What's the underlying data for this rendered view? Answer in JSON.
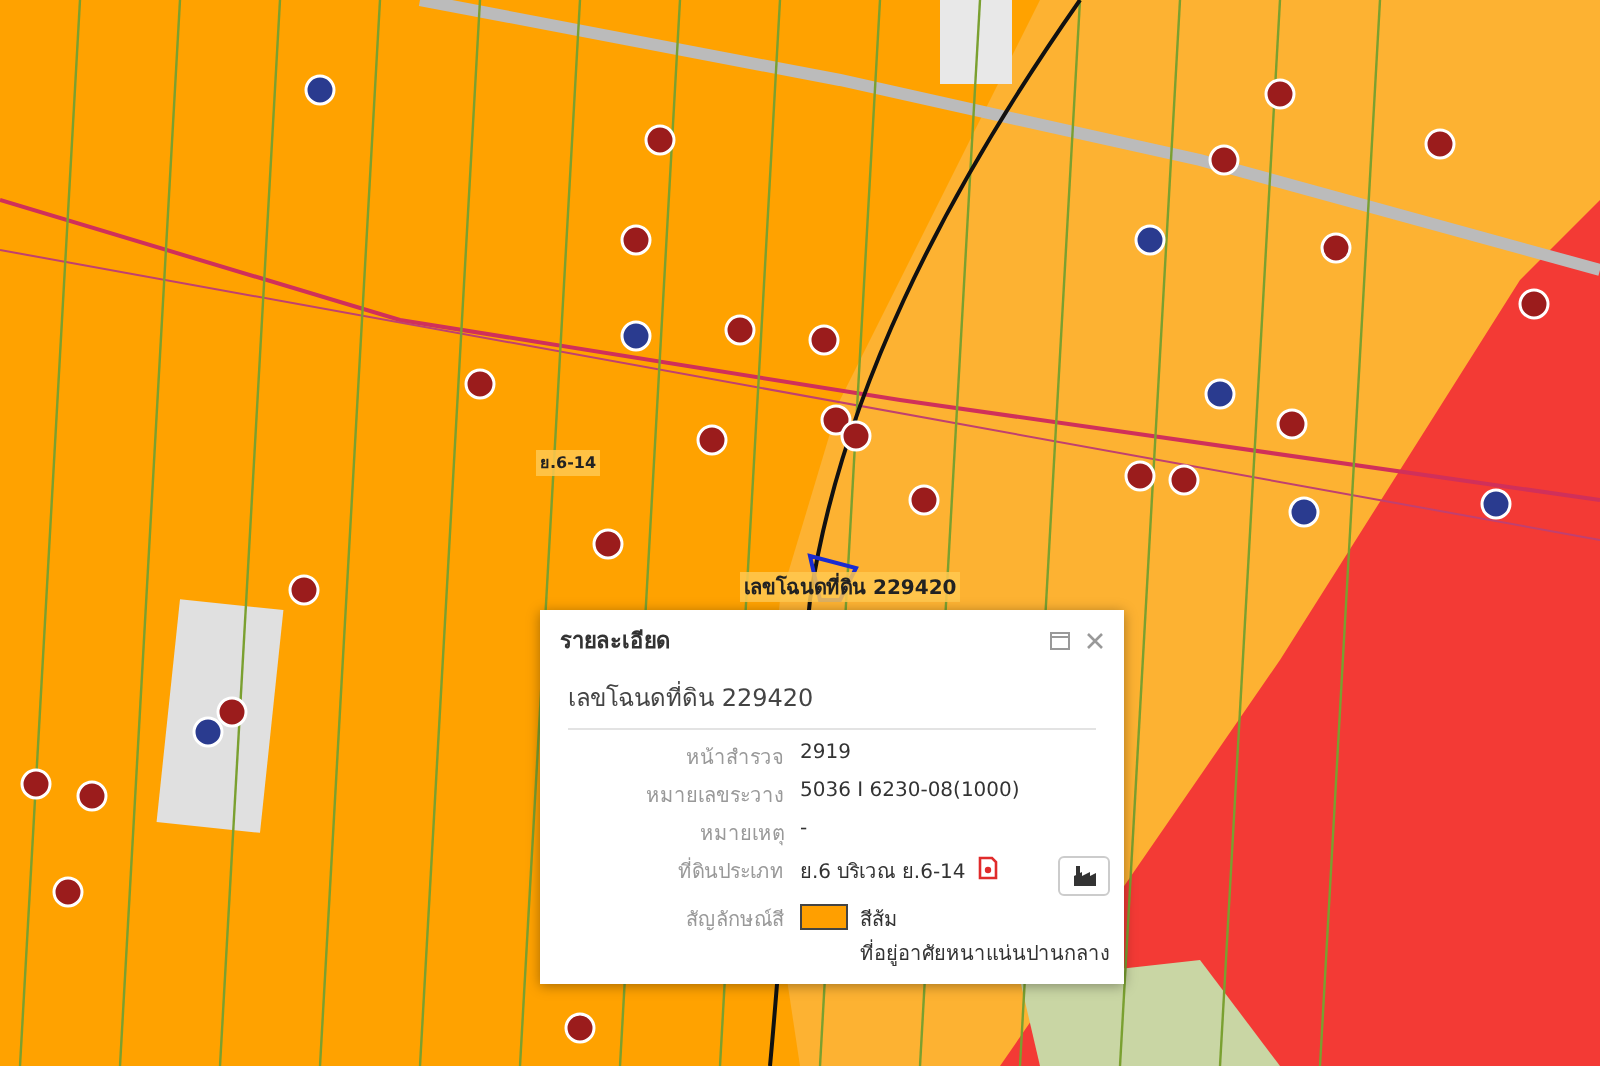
{
  "map": {
    "parcel_label": "เลขโฉนดที่ดิน 229420",
    "zone_label": "ย.6-14"
  },
  "popup": {
    "title": "รายละเอียด",
    "heading": "เลขโฉนดที่ดิน 229420",
    "rows": [
      {
        "kind": "text",
        "label": "หน้าสำรวจ",
        "value": "2919"
      },
      {
        "kind": "text",
        "label": "หมายเลขระวาง",
        "value": "5036 I 6230-08(1000)"
      },
      {
        "kind": "text",
        "label": "หมายเหตุ",
        "value": "-"
      },
      {
        "kind": "zone",
        "label": "ที่ดินประเภท",
        "value": "ย.6 บริเวณ ย.6-14"
      },
      {
        "kind": "legend",
        "label": "สัญลักษณ์สี",
        "color": "#ff9f00",
        "lines": [
          "สีส้ม",
          "ที่อยู่อาศัยหนาแน่นปานกลาง"
        ]
      }
    ]
  }
}
